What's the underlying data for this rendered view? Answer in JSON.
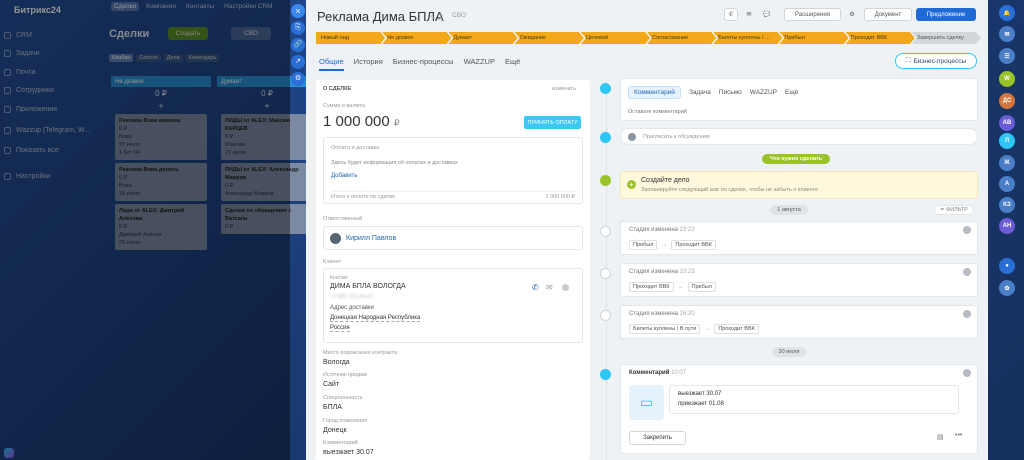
{
  "left_sidebar": {
    "logo": "Битрикс24",
    "items": [
      {
        "label": "CRM"
      },
      {
        "label": "Задачи"
      },
      {
        "label": "Почта"
      },
      {
        "label": "Сотрудники"
      },
      {
        "label": "Приложения"
      },
      {
        "label": "Wazzup (Telegram, W..."
      },
      {
        "label": "Показать все"
      },
      {
        "label": "Настройки"
      }
    ]
  },
  "crm": {
    "nav": [
      "Сделки",
      "Компании",
      "Контакты",
      "Настройки CRM",
      "Ещё"
    ],
    "title": "Сделки",
    "create": "Создать",
    "filter": "СВО",
    "views": [
      "Канбан",
      "Список",
      "Дела",
      "Календарь"
    ],
    "columns": [
      {
        "name": "Не дозвон",
        "count": "0 ₽",
        "color": "#2a8fd6",
        "cards": [
          {
            "title": "Реклама Вова явкевка",
            "sum": "0 ₽",
            "who": "Вова",
            "date": "27 июля",
            "status": "1 бот 04"
          },
          {
            "title": "Реклама Вова донись",
            "sum": "0 ₽",
            "who": "Вова",
            "date": "26 июля",
            "status": ""
          },
          {
            "title": "Лида от ALEX: Дмитрий Алёхова",
            "sum": "0 ₽",
            "who": "Дмитрий Алёхов",
            "date": "25 июля",
            "status": ""
          }
        ]
      },
      {
        "name": "Думает",
        "count": "0 ₽",
        "color": "#2a8fd6",
        "cards": [
          {
            "title": "ЛИДЫ от ALEX: Максим КАРЦЕВ",
            "sum": "0 ₽",
            "who": "Максим",
            "date": "27 июля",
            "status": ""
          },
          {
            "title": "ЛИДЫ от ALEX: Александр Мавров",
            "sum": "0 ₽",
            "who": "Александр Мавров",
            "date": "",
            "status": ""
          },
          {
            "title": "Сделка по обращению с Ватсапа",
            "sum": "0 ₽",
            "who": "",
            "date": "",
            "status": ""
          }
        ]
      }
    ]
  },
  "deal": {
    "title": "Реклама Дима БПЛА",
    "category": "СВО",
    "buttons": {
      "extensions": "Расширения",
      "document": "Документ",
      "offer": "Предложение"
    },
    "stages": [
      "Новый лид",
      "Не дозвон",
      "Думает",
      "Ожидание",
      "Целевой",
      "Согласование",
      "Билеты куплены / ...",
      "Прибыл",
      "Проходит ВВК",
      "Завершить сделку"
    ],
    "tabs": [
      "Общие",
      "История",
      "Бизнес-процессы",
      "WAZZUP",
      "Ещё"
    ],
    "bp_button": "Бизнес-процессы",
    "about": {
      "header": "О СДЕЛКЕ",
      "change": "изменить",
      "sum_label": "Сумма и валюта",
      "sum": "1 000 000",
      "currency": "₽",
      "pay_button": "ПРИНЯТЬ ОПЛАТУ",
      "payment_header": "Оплата и доставка",
      "payment_note": "Здесь будет информация об оплатах и доставках",
      "add": "Добавить",
      "total_label": "Итого к оплате по сделке",
      "total": "1 000 000 ₽",
      "responsible_label": "Ответственный",
      "responsible": "Кирилл Павлов",
      "client_label": "Клиент",
      "contact_label": "Контакт",
      "contact_name": "ДИМА БПЛА ВОЛОГДА",
      "phone": "+7 900 123-45-67",
      "address_label": "Адрес доставки",
      "address1": "Донецкая Народная Республика",
      "address2": "Россия",
      "fields": [
        {
          "label": "Место подписания контракта",
          "value": "Вологда"
        },
        {
          "label": "Источник продаж",
          "value": "Сайт"
        },
        {
          "label": "Специальность",
          "value": "БПЛА"
        },
        {
          "label": "Город пожелания",
          "value": "Донецк"
        },
        {
          "label": "Комментарий",
          "value": "выезжает 30.07"
        }
      ]
    },
    "activity": {
      "tabs": [
        "Комментарий",
        "Задача",
        "Письмо",
        "WAZZUP",
        "Ещё"
      ],
      "placeholder": "Оставьте комментарий",
      "discussion": "Пригласить к обсуждению",
      "todo_badge": "Что нужно сделать",
      "todo_title": "Создайте дело",
      "todo_sub": "Запланируйте следующий шаг по сделке, чтобы не забыть о клиенте",
      "date1": "1 августа",
      "filter": "ФИЛЬТР",
      "changes": [
        {
          "title": "Стадия изменена",
          "time": "23:23",
          "from": "Прибыл",
          "to": "Проходит ВВК"
        },
        {
          "title": "Стадия изменена",
          "time": "23:23",
          "from": "Проходит ВВК",
          "to": "Прибыл"
        },
        {
          "title": "Стадия изменена",
          "time": "16:20",
          "from": "Билеты куплены / В пути",
          "to": "Проходит ВВК"
        }
      ],
      "date2": "30 июля",
      "comment": {
        "title": "Комментарий",
        "time": "10:07",
        "line1": "выезжает 30.07",
        "line2": "приезжает 01.08",
        "pin": "Закрепить"
      }
    }
  },
  "right_sidebar": {
    "avatars": [
      {
        "label": "W",
        "color": "#9ac32b"
      },
      {
        "label": "ДС",
        "color": "#d0763e"
      },
      {
        "label": "АВ",
        "color": "#6b5bd6"
      },
      {
        "label": "Л",
        "color": "#2a8fd6"
      },
      {
        "label": "КЗ",
        "color": "#4a7fc8"
      },
      {
        "label": "АН",
        "color": "#6b5bd6"
      }
    ]
  }
}
